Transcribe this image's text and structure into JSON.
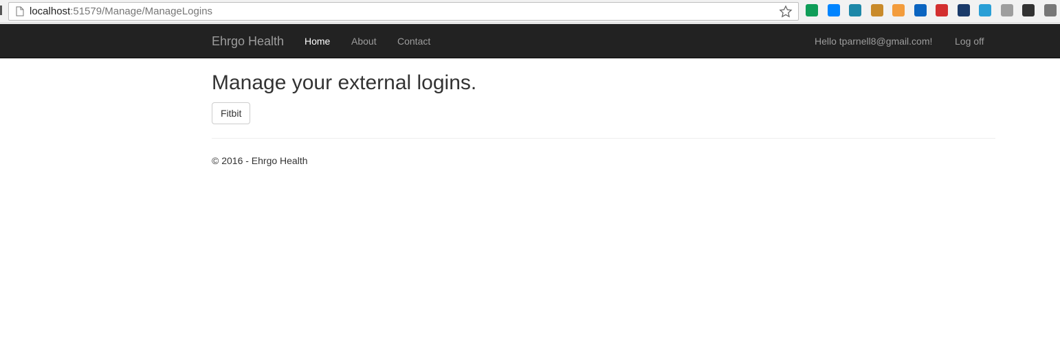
{
  "browser": {
    "url_host": "localhost",
    "url_path": ":51579/Manage/ManageLogins",
    "extensions": [
      {
        "name": "hangouts-icon",
        "color": "#0f9d58"
      },
      {
        "name": "messenger-icon",
        "color": "#0084ff"
      },
      {
        "name": "wave-icon",
        "color": "#1e88a8"
      },
      {
        "name": "bookmark-icon",
        "color": "#c98a2a"
      },
      {
        "name": "rss-icon",
        "color": "#f39c3c"
      },
      {
        "name": "skype-icon",
        "color": "#0b64c0"
      },
      {
        "name": "splat-icon",
        "color": "#d32f2f"
      },
      {
        "name": "app-icon",
        "color": "#1a3a6a"
      },
      {
        "name": "sync-icon",
        "color": "#2a9fd6"
      },
      {
        "name": "gear-icon",
        "color": "#9e9e9e"
      },
      {
        "name": "b-icon",
        "color": "#333333"
      },
      {
        "name": "feed-icon",
        "color": "#777777"
      }
    ]
  },
  "navbar": {
    "brand": "Ehrgo Health",
    "links": {
      "home": "Home",
      "about": "About",
      "contact": "Contact"
    },
    "user_greeting": "Hello tparnell8@gmail.com!",
    "logoff": "Log off"
  },
  "main": {
    "title": "Manage your external logins.",
    "provider_button": "Fitbit"
  },
  "footer": {
    "text": "© 2016 - Ehrgo Health"
  }
}
